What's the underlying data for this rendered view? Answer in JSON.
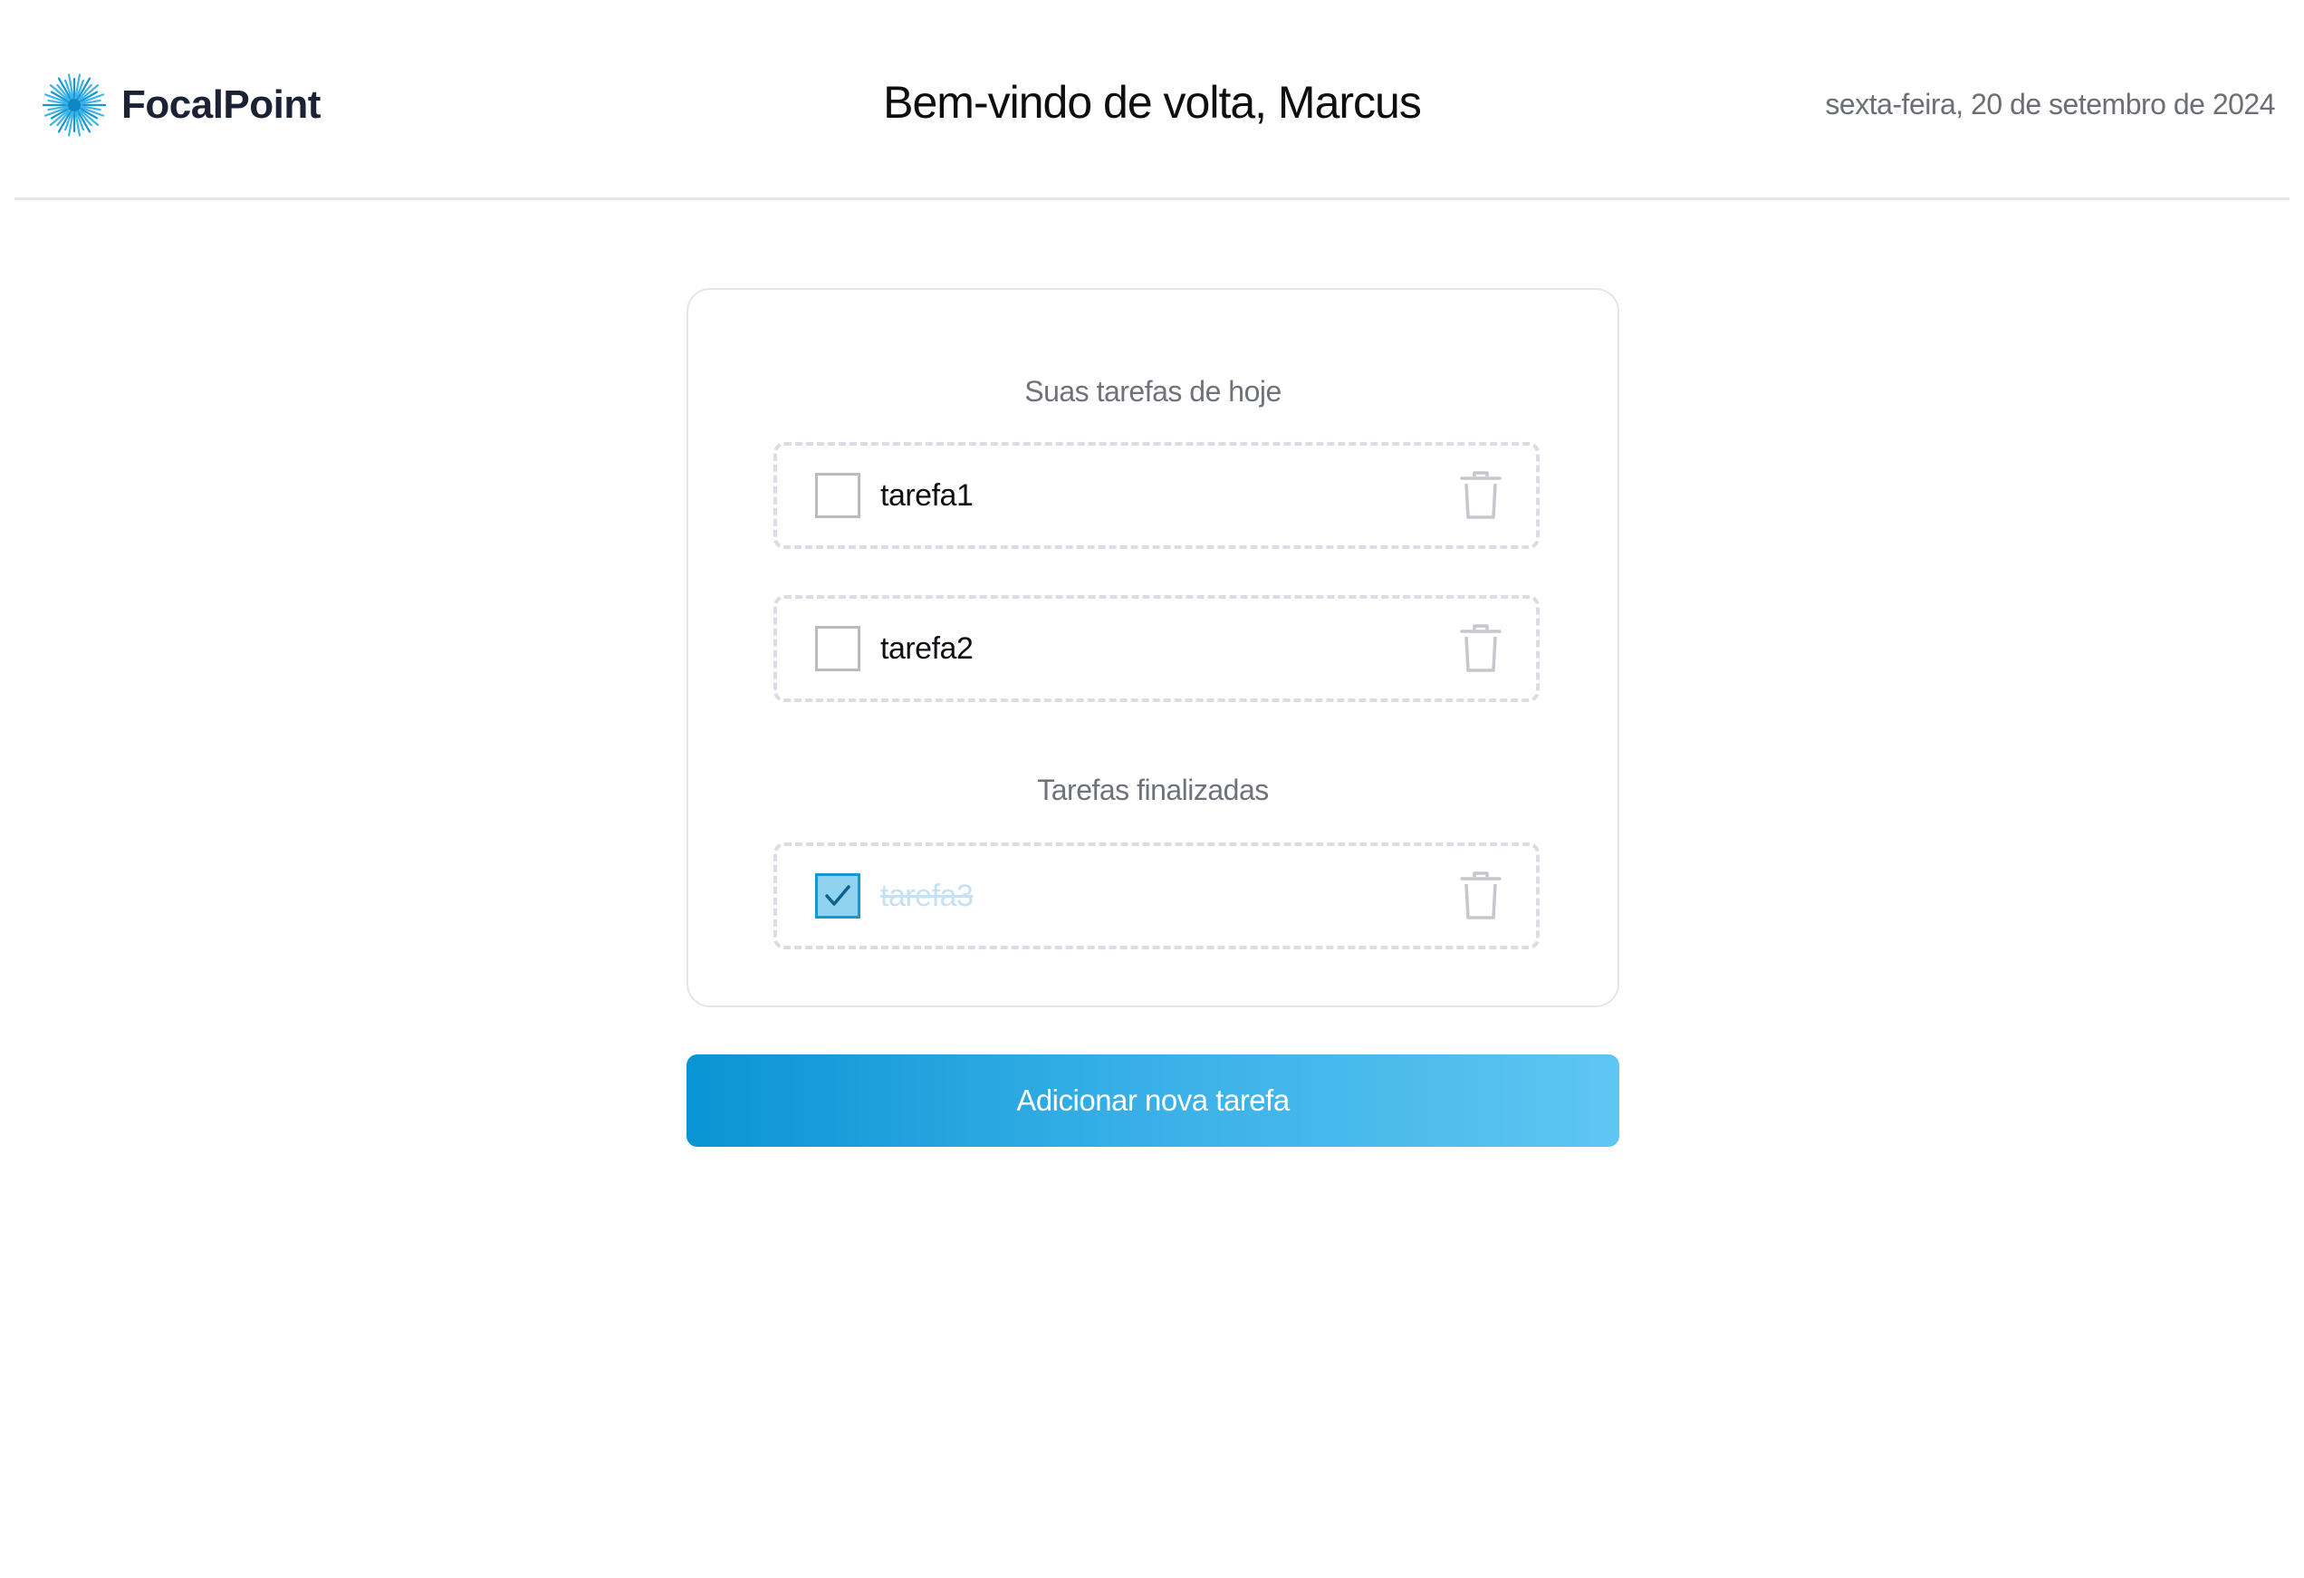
{
  "header": {
    "brand_name": "FocalPoint",
    "welcome": "Bem-vindo de volta, Marcus",
    "date": "sexta-feira, 20 de setembro de 2024",
    "logo_icon": "starburst-logo-icon"
  },
  "tasks": {
    "today_title": "Suas tarefas de hoje",
    "done_title": "Tarefas finalizadas",
    "items": [
      {
        "label": "tarefa1",
        "checked": false
      },
      {
        "label": "tarefa2",
        "checked": false
      }
    ],
    "done_items": [
      {
        "label": "tarefa3",
        "checked": true
      }
    ],
    "delete_icon": "trash-icon",
    "check_icon": "checkmark-icon"
  },
  "actions": {
    "add_task_label": "Adicionar nova tarefa"
  },
  "colors": {
    "accent": "#1597d6",
    "accent_light": "#5ec6f2",
    "checked_fill": "#8fd3f1",
    "brand_text": "#1b2233"
  }
}
